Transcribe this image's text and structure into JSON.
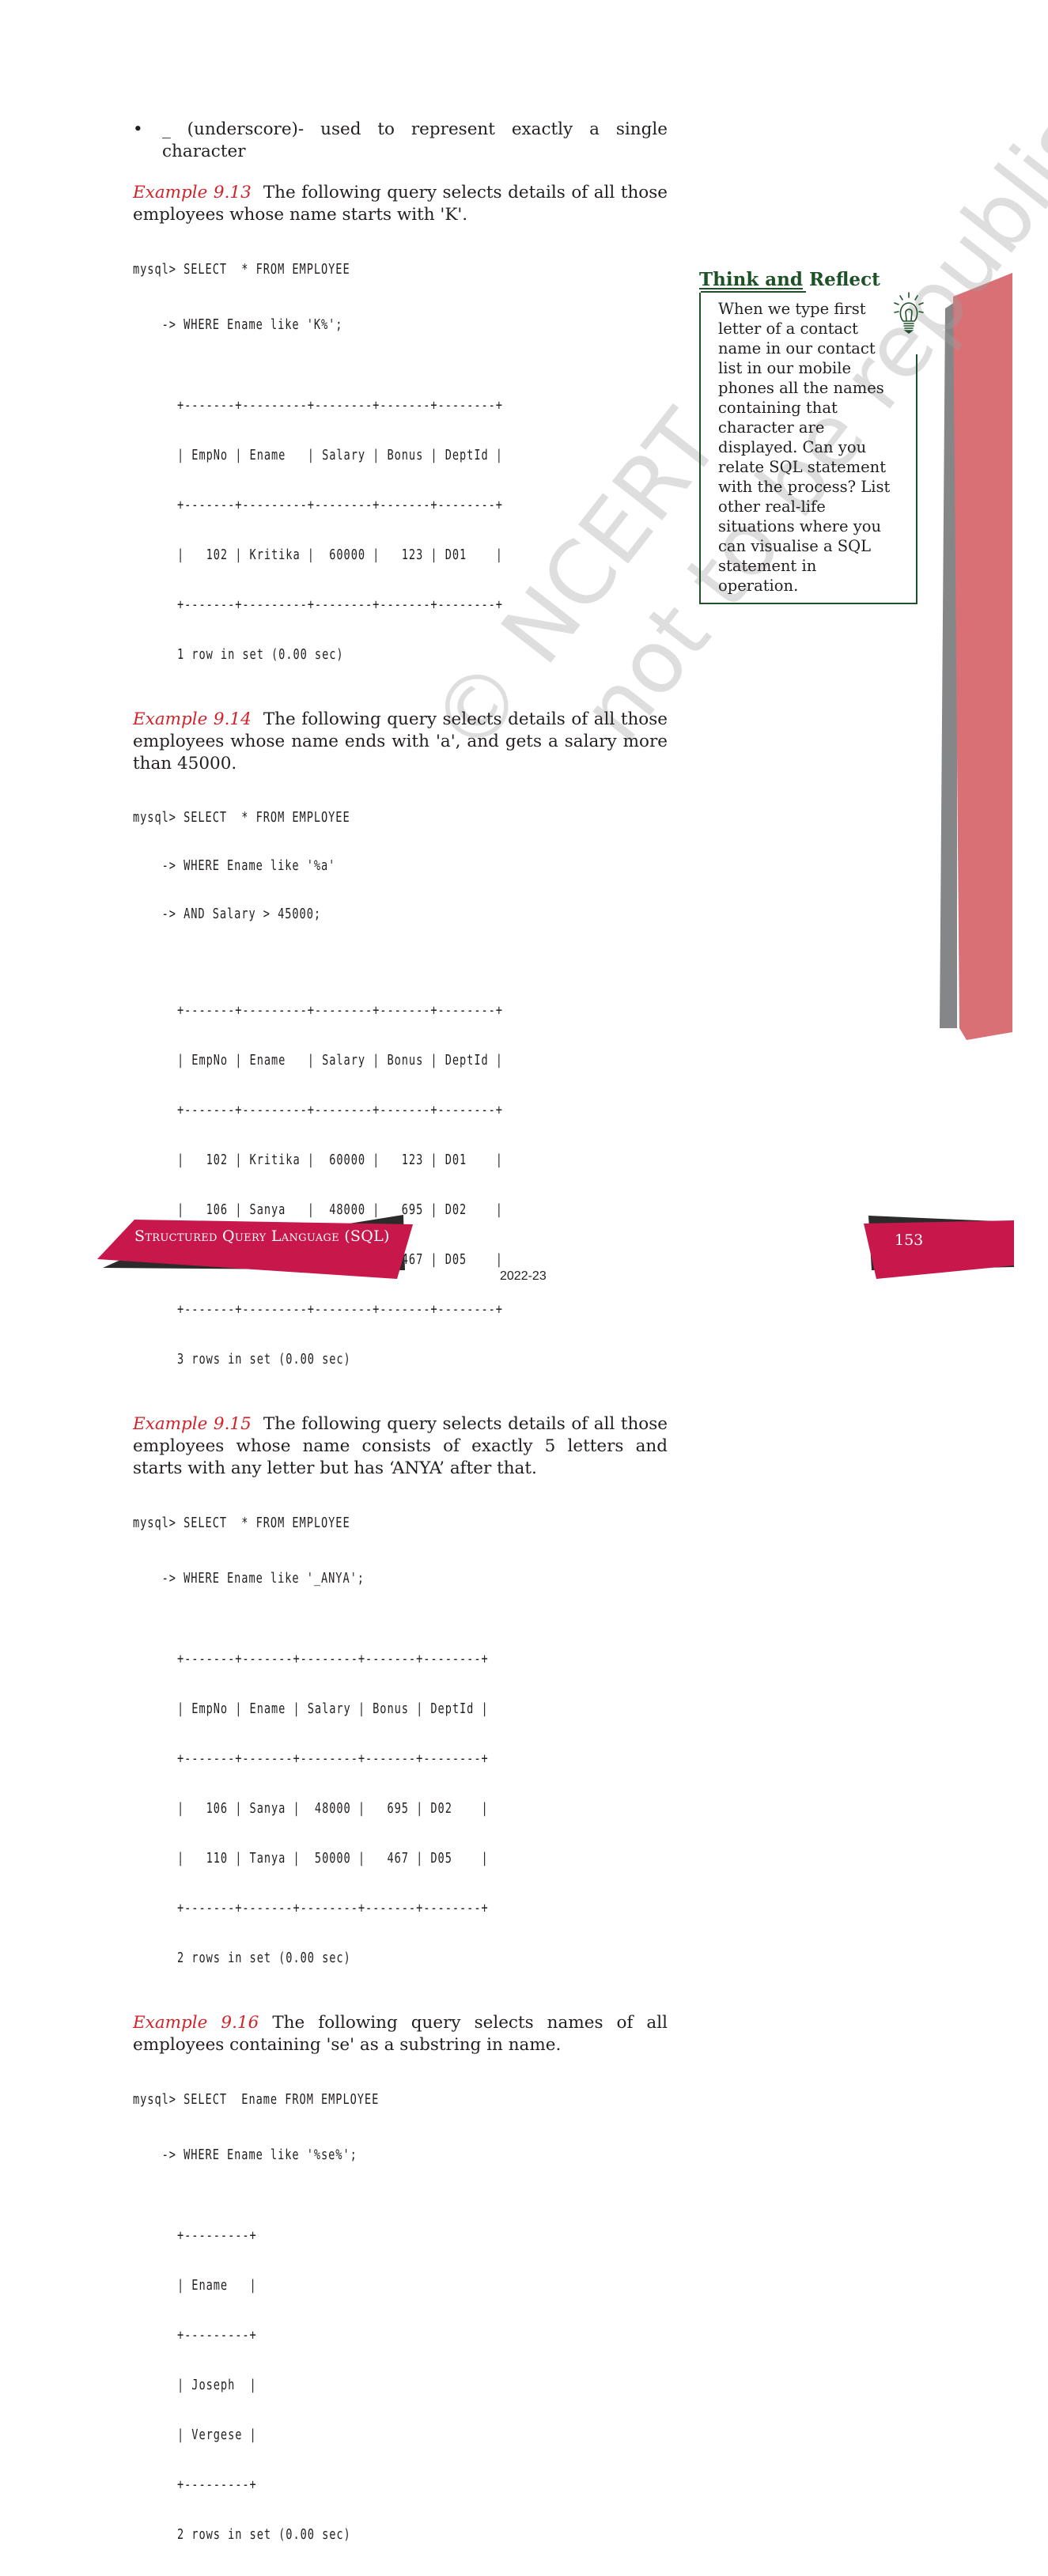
{
  "colors": {
    "example_label": "#d2232a",
    "reflect_green": "#1e5128",
    "strip_red": "#d87076",
    "strip_gray": "#858687",
    "footer_red": "#c8174a",
    "footer_shadow": "#2c2a2b"
  },
  "bullet": {
    "symbol": "•",
    "text": "_ (underscore)- used to represent exactly a single character"
  },
  "examples": [
    {
      "label": "Example 9.13",
      "description": "The following query selects details of all those employees whose name starts with 'K'.",
      "query": [
        "mysql> SELECT  * FROM EMPLOYEE",
        "    -> WHERE Ename like 'K%';"
      ],
      "table": [
        "+-------+---------+--------+-------+--------+",
        "| EmpNo | Ename   | Salary | Bonus | DeptId |",
        "+-------+---------+--------+-------+--------+",
        "|   102 | Kritika |  60000 |   123 | D01    |",
        "+-------+---------+--------+-------+--------+"
      ],
      "result": "1 row in set (0.00 sec)"
    },
    {
      "label": "Example 9.14",
      "description": "The following query selects details of all those employees whose name ends with 'a', and gets a salary more than 45000.",
      "query": [
        "mysql> SELECT  * FROM EMPLOYEE",
        "    -> WHERE Ename like '%a'",
        "    -> AND Salary > 45000;"
      ],
      "table": [
        "+-------+---------+--------+-------+--------+",
        "| EmpNo | Ename   | Salary | Bonus | DeptId |",
        "+-------+---------+--------+-------+--------+",
        "|   102 | Kritika |  60000 |   123 | D01    |",
        "|   106 | Sanya   |  48000 |   695 | D02    |",
        "|   110 | Tanya   |  50000 |   467 | D05    |",
        "+-------+---------+--------+-------+--------+"
      ],
      "result": "3 rows in set (0.00 sec)"
    },
    {
      "label": "Example 9.15",
      "description": "The following query selects details of all those employees whose name consists of exactly 5 letters and starts with any letter but has ‘ANYA’ after that.",
      "query": [
        "mysql> SELECT  * FROM EMPLOYEE",
        "    -> WHERE Ename like '_ANYA';"
      ],
      "table": [
        "+-------+-------+--------+-------+--------+",
        "| EmpNo | Ename | Salary | Bonus | DeptId |",
        "+-------+-------+--------+-------+--------+",
        "|   106 | Sanya |  48000 |   695 | D02    |",
        "|   110 | Tanya |  50000 |   467 | D05    |",
        "+-------+-------+--------+-------+--------+"
      ],
      "result": "2 rows in set (0.00 sec)"
    },
    {
      "label": "Example 9.16",
      "description": "The following query selects names of all employees containing 'se' as a substring in name.",
      "query": [
        "mysql> SELECT  Ename FROM EMPLOYEE",
        "    -> WHERE Ename like '%se%';"
      ],
      "table": [
        "+---------+",
        "| Ename   |",
        "+---------+",
        "| Joseph  |",
        "| Vergese |",
        "+---------+"
      ],
      "result": "2 rows in set (0.00 sec)"
    }
  ],
  "reflect": {
    "title_part1": "Think and",
    "title_part2": " Reflect",
    "icon": "lightbulb-icon",
    "text": "When we type first letter of a contact name in our contact list in our mobile phones all the names containing that character are displayed. Can you relate SQL statement with the process? List other real-life situations where you can visualise a SQL statement in operation."
  },
  "watermark": {
    "line1": "© NCERT",
    "line2": "not to be republished"
  },
  "footer": {
    "chapter_title": "Structured Query Language (SQL)",
    "page_number": "153",
    "year": "2022-23"
  }
}
